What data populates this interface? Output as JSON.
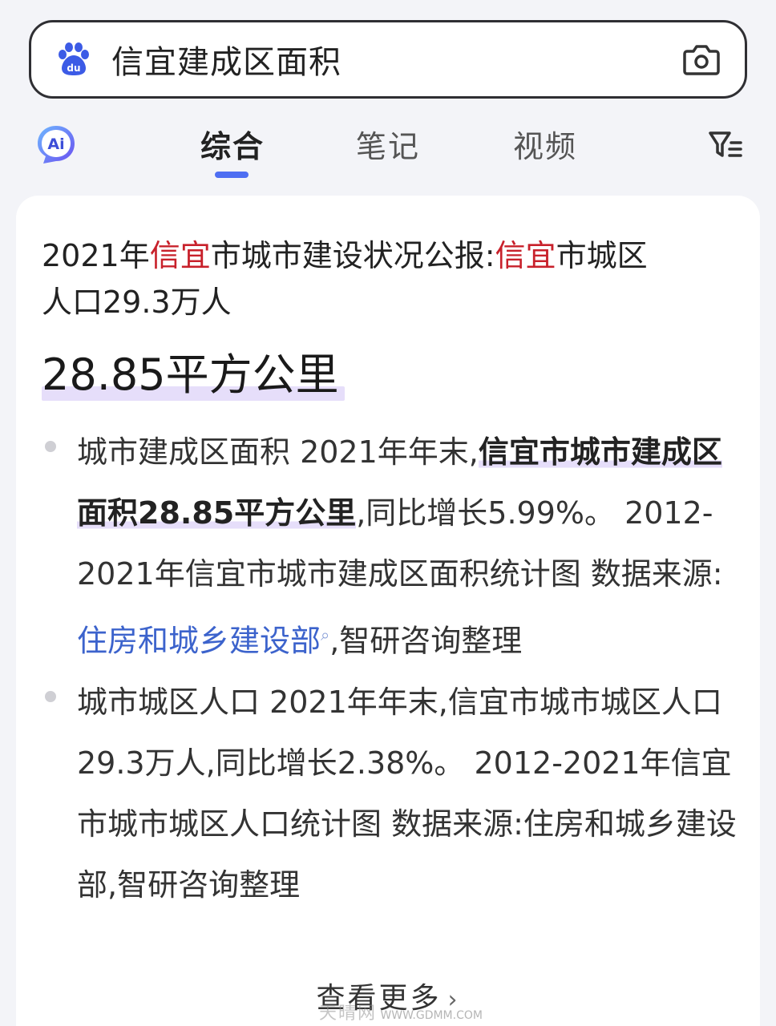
{
  "search": {
    "query": "信宜建成区面积",
    "logo_icon": "baidu-paw-du-logo",
    "camera_icon": "camera-icon"
  },
  "tabs": {
    "ai_icon": "ai-assistant-badge-icon",
    "items": [
      {
        "label": "综合",
        "active": true
      },
      {
        "label": "笔记",
        "active": false
      },
      {
        "label": "视频",
        "active": false
      }
    ],
    "filter_icon": "filter-icon"
  },
  "result": {
    "title_parts": [
      "2021年",
      "信宜",
      "市城市建设状况公报:",
      "信宜",
      "市城区",
      "人口29.3万人"
    ],
    "answer": "28.85平方公里",
    "bullets": [
      {
        "lead": "城市建成区面积 2021年年末,",
        "strong": "信宜市城市建成区面积28.85平方公里",
        "after": ",同比增长5.99%。 2012-2021年信宜市城市建成区面积统计图 数据来源:",
        "link": "住房和城乡建设部",
        "tail": ",智研咨询整理"
      },
      {
        "text": "城市城区人口 2021年年末,信宜市城市城区人口29.3万人,同比增长2.38%。 2012-2021年信宜市城市城区人口统计图 数据来源:住房和城乡建设部,智研咨询整理"
      }
    ],
    "see_more": "查看更多"
  },
  "watermark": {
    "cn": "天晴网",
    "url": "WWW.GDMM.COM"
  },
  "colors": {
    "accent": "#4e6ef2",
    "highlight_red": "#c8212b",
    "link_blue": "#3c63cc",
    "mark_purple": "#e6defa"
  }
}
